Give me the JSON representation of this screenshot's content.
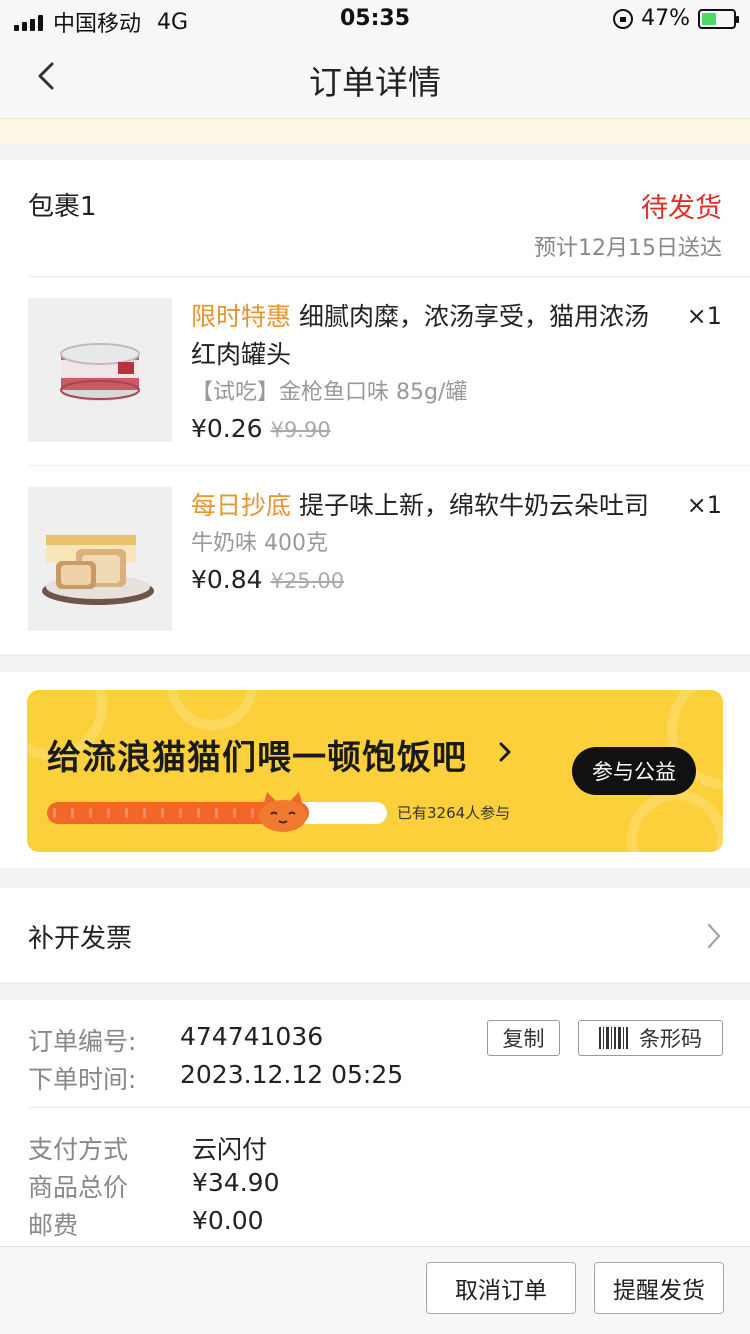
{
  "status_bar": {
    "carrier": "中国移动",
    "network": "4G",
    "time": "05:35",
    "battery": "47%",
    "battery_level": 0.47
  },
  "nav": {
    "title": "订单详情"
  },
  "package": {
    "title": "包裹1",
    "status": "待发货",
    "eta": "预计12月15日送达",
    "status_color": "#e02e24",
    "items": [
      {
        "tag": "限时特惠",
        "name": "细腻肉糜，浓汤享受，猫用浓汤红肉罐头",
        "spec": "【试吃】金枪鱼口味 85g/罐",
        "price": "¥0.26",
        "original_price": "¥9.90",
        "quantity": "×1"
      },
      {
        "tag": "每日抄底",
        "name": "提子味上新，绵软牛奶云朵吐司",
        "spec": "牛奶味 400克",
        "price": "¥0.84",
        "original_price": "¥25.00",
        "quantity": "×1"
      }
    ]
  },
  "charity": {
    "title": "给流浪猫猫们喂一顿饱饭吧",
    "button": "参与公益",
    "participants": "已有3264人参与",
    "progress": 0.77
  },
  "invoice": {
    "label": "补开发票"
  },
  "order": {
    "number_label": "订单编号:",
    "number": "474741036",
    "copy_button": "复制",
    "barcode_button": "条形码",
    "time_label": "下单时间:",
    "time": "2023.12.12 05:25",
    "payment_label": "支付方式",
    "payment": "云闪付",
    "total_label": "商品总价",
    "total": "¥34.90",
    "shipping_label": "邮费",
    "shipping": "¥0.00"
  },
  "actions": {
    "cancel": "取消订单",
    "remind": "提醒发货"
  },
  "colors": {
    "accent_tag": "#e8942f",
    "banner": "#fcd03a",
    "progress": "#f2662a"
  }
}
